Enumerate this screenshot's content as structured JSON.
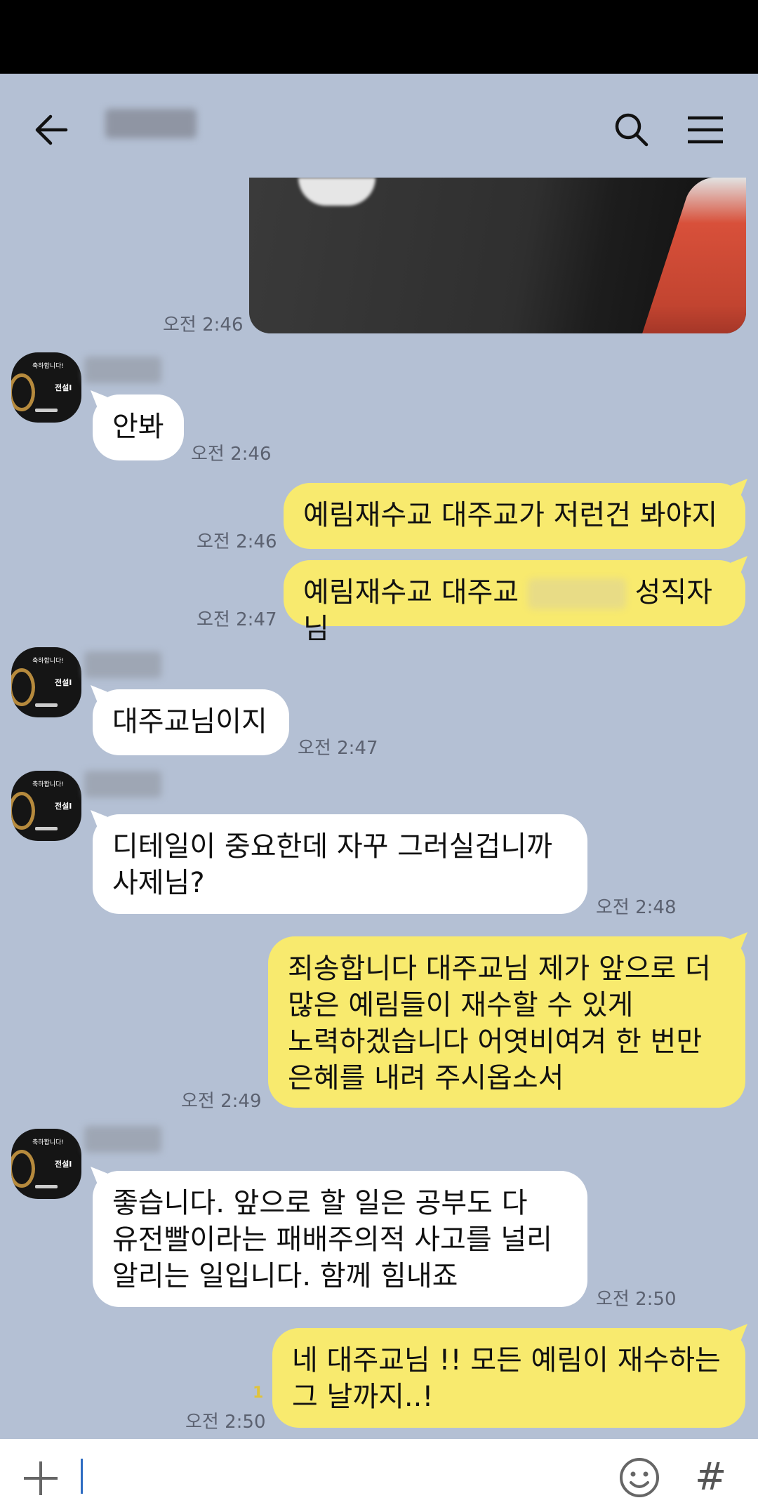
{
  "header": {
    "back": "arrow-left",
    "search": "search",
    "menu": "hamburger"
  },
  "messages": [
    {
      "type": "image",
      "dir": "out",
      "time": "오전 2:46"
    },
    {
      "type": "text",
      "dir": "in",
      "text": "안봐",
      "time": "오전 2:46"
    },
    {
      "type": "text",
      "dir": "out",
      "text": "예림재수교 대주교가 저런건 봐야지",
      "time": "오전 2:46"
    },
    {
      "type": "text",
      "dir": "out",
      "text_before": "예림재수교 대주교",
      "text_after": "성직자님",
      "time": "오전 2:47"
    },
    {
      "type": "text",
      "dir": "in",
      "text": "대주교님이지",
      "time": "오전 2:47"
    },
    {
      "type": "text",
      "dir": "in",
      "lines": [
        "디테일이 중요한데 자꾸 그러실겁니까",
        "사제님?"
      ],
      "time": "오전 2:48"
    },
    {
      "type": "text",
      "dir": "out",
      "lines": [
        "죄송합니다 대주교님 제가 앞으로 더",
        "많은 예림들이 재수할 수 있게",
        "노력하겠습니다 어엿비여겨 한 번만",
        "은혜를 내려 주시옵소서"
      ],
      "time": "오전 2:49"
    },
    {
      "type": "text",
      "dir": "in",
      "lines": [
        "좋습니다. 앞으로 할 일은 공부도 다",
        "유전빨이라는 패배주의적 사고를 널리",
        "알리는 일입니다. 함께 힘내죠"
      ],
      "time": "오전 2:50"
    },
    {
      "type": "text",
      "dir": "out",
      "lines": [
        "네 대주교님 !! 모든 예림이 재수하는",
        "그 날까지..!"
      ],
      "unread": "1",
      "time": "오전 2:50"
    }
  ],
  "avatar": {
    "line1": "축하합니다!",
    "line2": "전설I"
  },
  "input": {
    "placeholder": "",
    "plus_icon": "plus",
    "emoji_icon": "smiley",
    "hash": "#"
  },
  "colors": {
    "background": "#b4c0d4",
    "outgoing": "#f8ea6e",
    "incoming": "#ffffff"
  }
}
